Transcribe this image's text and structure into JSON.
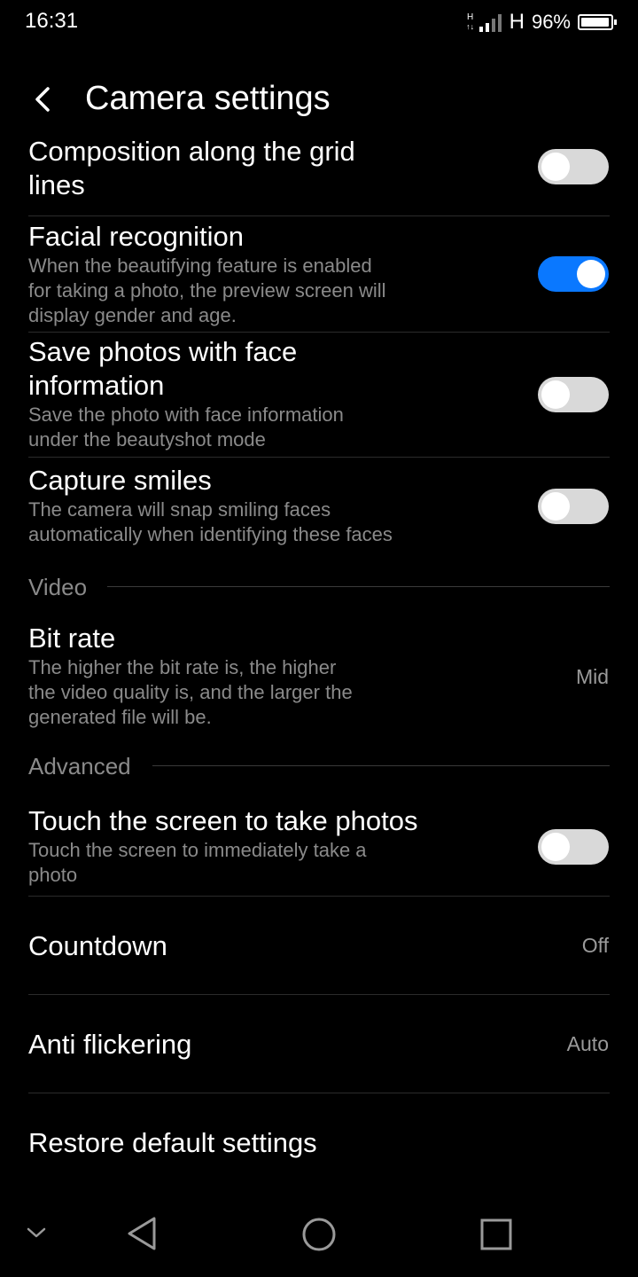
{
  "status_bar": {
    "time": "16:31",
    "network_mini": "H",
    "network_type": "H",
    "battery_percent": "96%",
    "battery_level": 0.96,
    "signal_bars_active": 2
  },
  "header": {
    "title": "Camera settings",
    "back_icon": "chevron-left-icon"
  },
  "items": {
    "grid_lines": {
      "title_line1": "Composition along the grid",
      "title_line2": "lines",
      "enabled": false
    },
    "facial_recognition": {
      "title": "Facial recognition",
      "sub_line1": "When the beautifying feature is enabled",
      "sub_line2": "for taking a photo, the preview screen will",
      "sub_line3": "display gender and age.",
      "enabled": true
    },
    "save_face": {
      "title_line1": "Save photos with face",
      "title_line2": "information",
      "sub_line1": "Save the photo with face information",
      "sub_line2": "under the beautyshot mode",
      "enabled": false
    },
    "capture_smiles": {
      "title": "Capture smiles",
      "sub_line1": "The camera will snap smiling faces",
      "sub_line2": "automatically when identifying these faces",
      "enabled": false
    }
  },
  "sections": {
    "video": "Video",
    "advanced": "Advanced"
  },
  "bit_rate": {
    "title": "Bit rate",
    "sub_line1": "The higher the bit rate is, the higher",
    "sub_line2": "the video quality is, and the larger the",
    "sub_line3": "generated file will be.",
    "value": "Mid"
  },
  "touch_photo": {
    "title": "Touch the screen to take photos",
    "sub_line1": "Touch the screen to immediately take a",
    "sub_line2": "photo",
    "enabled": false
  },
  "countdown": {
    "title": "Countdown",
    "value": "Off"
  },
  "anti_flicker": {
    "title": "Anti flickering",
    "value": "Auto"
  },
  "restore": {
    "title": "Restore default settings"
  },
  "nav": {
    "icons": [
      "chevron-down-icon",
      "back-triangle-icon",
      "home-circle-icon",
      "recents-square-icon"
    ]
  },
  "colors": {
    "accent": "#0a78ff",
    "background": "#000000",
    "toggle_off": "#d9d9d9",
    "secondary_text": "#8a8a8a"
  }
}
